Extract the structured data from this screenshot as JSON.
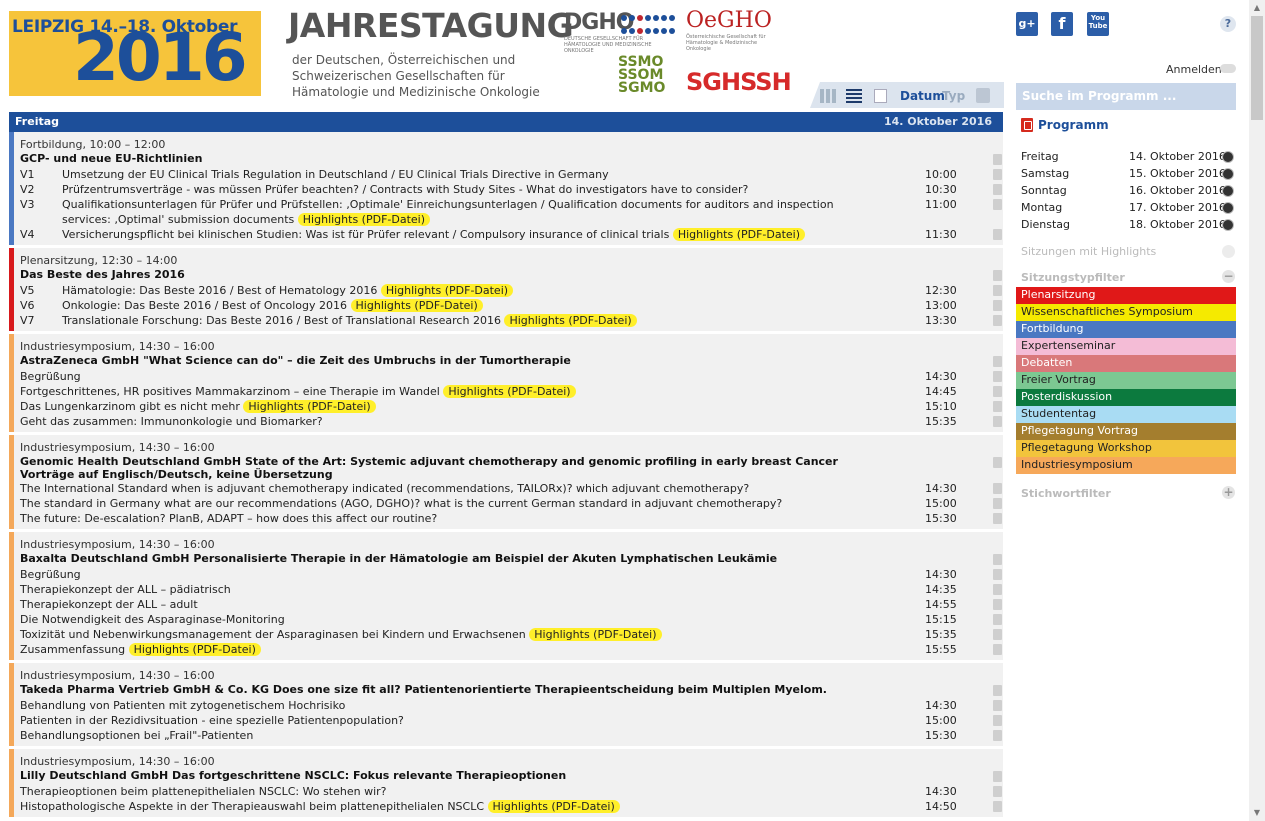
{
  "header": {
    "logo_city": "LEIPZIG 14.–18. Oktober",
    "logo_year": "2016",
    "title": "JAHRESTAGUNG",
    "subtitle": "der Deutschen, Österreichischen und Schweizerischen Gesellschaften für Hämatologie und Medizinische Onkologie",
    "dgho": "DGHO",
    "dgho_small": "DEUTSCHE GESELLSCHAFT FÜR HÄMATOLOGIE UND MEDIZINISCHE ONKOLOGIE",
    "oegho": "OeGHO",
    "oegho_small": "Österreichische Gesellschaft für Hämatologie & Medizinische Onkologie",
    "ssmo_lines": [
      "SSMO",
      "SSOM",
      "SGMO"
    ],
    "sghssh": "SGHSSH",
    "login": "Anmelden",
    "help": "?",
    "social": {
      "gplus": "g+",
      "fb": "f",
      "yt": "You Tube"
    }
  },
  "toolbar": {
    "datum": "Datum",
    "typ": "Typ"
  },
  "day": {
    "name": "Freitag",
    "date": "14. Oktober 2016"
  },
  "colors": {
    "plenarsitzung": "#d7191c",
    "fortbildung": "#4a78c2",
    "industriesymposium": "#f4a85a",
    "highlight": "#ffef2a",
    "accent": "#1d4f9a"
  },
  "sessions": [
    {
      "meta": "Fortbildung, 10:00 – 12:00",
      "title": "GCP- und neue EU-Richtlinien",
      "color": "#4a78c2",
      "items": [
        {
          "code": "V1",
          "text": "Umsetzung der EU Clinical Trials Regulation in Deutschland / EU Clinical Trials Directive in Germany",
          "time": "10:00",
          "hl": ""
        },
        {
          "code": "V2",
          "text": "Prüfzentrumsverträge - was müssen Prüfer beachten? / Contracts with Study Sites - What do investigators have to consider?",
          "time": "10:30",
          "hl": ""
        },
        {
          "code": "V3",
          "text": "Qualifikationsunterlagen für Prüfer und Prüfstellen: ‚Optimale' Einreichungsunterlagen / Qualification documents for auditors and inspection services: ‚Optimal' submission documents",
          "time": "11:00",
          "hl": "Highlights (PDF-Datei)"
        },
        {
          "code": "V4",
          "text": "Versicherungspflicht bei klinischen Studien: Was ist für Prüfer relevant / Compulsory insurance of clinical trials",
          "time": "11:30",
          "hl": "Highlights (PDF-Datei)"
        }
      ]
    },
    {
      "meta": "Plenarsitzung, 12:30 – 14:00",
      "title": "Das Beste des Jahres 2016",
      "color": "#d7191c",
      "items": [
        {
          "code": "V5",
          "text": "Hämatologie: Das Beste 2016 / Best of Hematology 2016",
          "time": "12:30",
          "hl": "Highlights (PDF-Datei)"
        },
        {
          "code": "V6",
          "text": "Onkologie: Das Beste 2016 / Best of Oncology 2016",
          "time": "13:00",
          "hl": "Highlights (PDF-Datei)"
        },
        {
          "code": "V7",
          "text": "Translationale Forschung: Das Beste 2016 / Best of Translational Research 2016",
          "time": "13:30",
          "hl": "Highlights (PDF-Datei)"
        }
      ]
    },
    {
      "meta": "Industriesymposium, 14:30 – 16:00",
      "title": "AstraZeneca GmbH \"What Science can do\" – die Zeit des Umbruchs in der Tumortherapie",
      "color": "#f4a85a",
      "items": [
        {
          "code": "",
          "text": "Begrüßung",
          "time": "14:30",
          "hl": ""
        },
        {
          "code": "",
          "text": "Fortgeschrittenes, HR positives Mammakarzinom – eine Therapie im Wandel",
          "time": "14:45",
          "hl": "Highlights (PDF-Datei)"
        },
        {
          "code": "",
          "text": "Das Lungenkarzinom gibt es nicht mehr",
          "time": "15:10",
          "hl": "Highlights (PDF-Datei)"
        },
        {
          "code": "",
          "text": "Geht das zusammen: Immunonkologie und Biomarker?",
          "time": "15:35",
          "hl": ""
        }
      ]
    },
    {
      "meta": "Industriesymposium, 14:30 – 16:00",
      "title": "Genomic Health Deutschland GmbH State of the Art: Systemic adjuvant chemotherapy and genomic profiling in early breast Cancer Vorträge auf Englisch/Deutsch, keine Übersetzung",
      "color": "#f4a85a",
      "items": [
        {
          "code": "",
          "text": "The International Standard when is adjuvant chemotherapy indicated (recommendations, TAILORx)? which adjuvant chemotherapy?",
          "time": "14:30",
          "hl": ""
        },
        {
          "code": "",
          "text": "The standard in Germany what are our recommendations (AGO, DGHO)? what is the current German standard in adjuvant chemotherapy?",
          "time": "15:00",
          "hl": ""
        },
        {
          "code": "",
          "text": "The future: De-escalation? PlanB, ADAPT – how does this affect our routine?",
          "time": "15:30",
          "hl": ""
        }
      ]
    },
    {
      "meta": "Industriesymposium, 14:30 – 16:00",
      "title": "Baxalta Deutschland GmbH Personalisierte Therapie in der Hämatologie am Beispiel der Akuten Lymphatischen Leukämie",
      "color": "#f4a85a",
      "items": [
        {
          "code": "",
          "text": "Begrüßung",
          "time": "14:30",
          "hl": ""
        },
        {
          "code": "",
          "text": "Therapiekonzept der ALL – pädiatrisch",
          "time": "14:35",
          "hl": ""
        },
        {
          "code": "",
          "text": "Therapiekonzept der ALL – adult",
          "time": "14:55",
          "hl": ""
        },
        {
          "code": "",
          "text": "Die Notwendigkeit des Asparaginase-Monitoring",
          "time": "15:15",
          "hl": ""
        },
        {
          "code": "",
          "text": "Toxizität und Nebenwirkungsmanagement der Asparaginasen bei Kindern und Erwachsenen",
          "time": "15:35",
          "hl": "Highlights (PDF-Datei)"
        },
        {
          "code": "",
          "text": "Zusammenfassung",
          "time": "15:55",
          "hl": "Highlights (PDF-Datei)"
        }
      ]
    },
    {
      "meta": "Industriesymposium, 14:30 – 16:00",
      "title": "Takeda Pharma Vertrieb GmbH & Co. KG Does one size fit all? Patientenorientierte Therapieentscheidung beim Multiplen Myelom.",
      "color": "#f4a85a",
      "items": [
        {
          "code": "",
          "text": "Behandlung von Patienten mit zytogenetischem Hochrisiko",
          "time": "14:30",
          "hl": ""
        },
        {
          "code": "",
          "text": "Patienten in der Rezidivsituation - eine spezielle Patientenpopulation?",
          "time": "15:00",
          "hl": ""
        },
        {
          "code": "",
          "text": "Behandlungsoptionen bei „Frail\"-Patienten",
          "time": "15:30",
          "hl": ""
        }
      ]
    },
    {
      "meta": "Industriesymposium, 14:30 – 16:00",
      "title": "Lilly Deutschland GmbH Das fortgeschrittene NSCLC: Fokus relevante Therapieoptionen",
      "color": "#f4a85a",
      "items": [
        {
          "code": "",
          "text": "Therapieoptionen beim plattenepithelialen NSCLC: Wo stehen wir?",
          "time": "14:30",
          "hl": ""
        },
        {
          "code": "",
          "text": "Histopathologische Aspekte in der Therapieauswahl beim plattenepithelialen NSCLC",
          "time": "14:50",
          "hl": "Highlights (PDF-Datei)"
        }
      ]
    }
  ],
  "sidebar": {
    "search_placeholder": "Suche im Programm ...",
    "programm": "Programm",
    "days": [
      {
        "name": "Freitag",
        "date": "14. Oktober 2016"
      },
      {
        "name": "Samstag",
        "date": "15. Oktober 2016"
      },
      {
        "name": "Sonntag",
        "date": "16. Oktober 2016"
      },
      {
        "name": "Montag",
        "date": "17. Oktober 2016"
      },
      {
        "name": "Dienstag",
        "date": "18. Oktober 2016"
      }
    ],
    "highlights_filter": "Sitzungen mit Highlights",
    "type_filter_title": "Sitzungstypfilter",
    "types": [
      {
        "label": "Plenarsitzung",
        "bg": "#e01818",
        "fg": "#ffffff"
      },
      {
        "label": "Wissenschaftliches Symposium",
        "bg": "#f5ea00",
        "fg": "#222222"
      },
      {
        "label": "Fortbildung",
        "bg": "#4a78c2",
        "fg": "#ffffff"
      },
      {
        "label": "Expertenseminar",
        "bg": "#f4bcd6",
        "fg": "#222222"
      },
      {
        "label": "Debatten",
        "bg": "#d9787a",
        "fg": "#ffffff"
      },
      {
        "label": "Freier Vortrag",
        "bg": "#7cc892",
        "fg": "#222222"
      },
      {
        "label": "Posterdiskussion",
        "bg": "#0c7a3e",
        "fg": "#ffffff"
      },
      {
        "label": "Studententag",
        "bg": "#a9dcf3",
        "fg": "#222222"
      },
      {
        "label": "Pflegetagung Vortrag",
        "bg": "#a47e2e",
        "fg": "#ffffff"
      },
      {
        "label": "Pflegetagung Workshop",
        "bg": "#f2c43c",
        "fg": "#222222"
      },
      {
        "label": "Industriesymposium",
        "bg": "#f6a85a",
        "fg": "#222222"
      }
    ],
    "keyword_filter_title": "Stichwortfilter"
  }
}
